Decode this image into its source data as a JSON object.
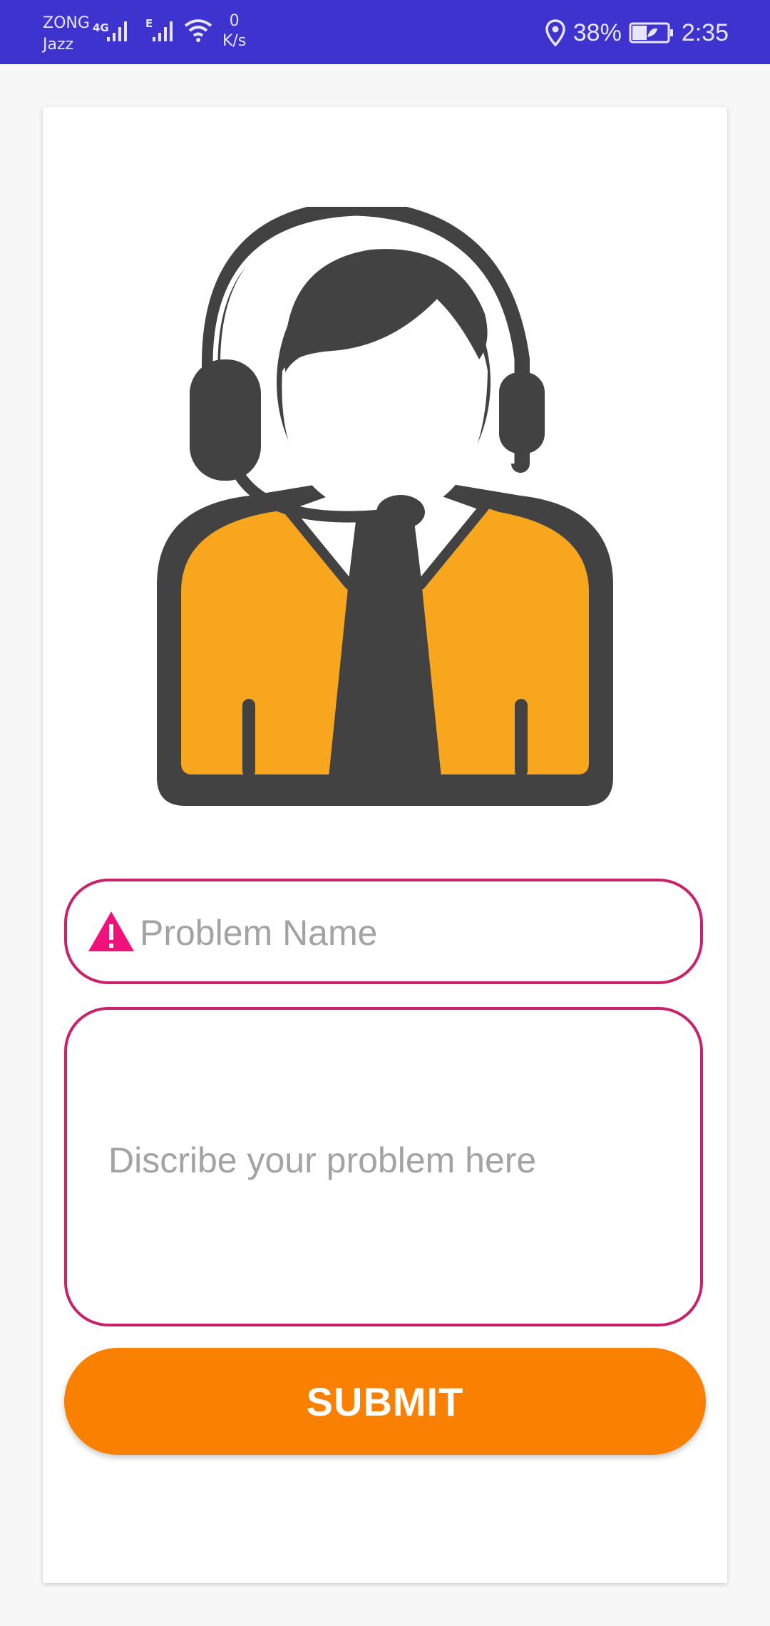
{
  "status_bar": {
    "carrier1": "ZONG",
    "network1": "4G",
    "carrier2": "Jazz",
    "network2": "E",
    "speed_value": "0",
    "speed_unit": "K/s",
    "battery": "38%",
    "time": "2:35"
  },
  "form": {
    "problem_name_placeholder": "Problem Name",
    "description_placeholder": "Discribe your problem here",
    "submit_label": "SUBMIT"
  },
  "colors": {
    "status_bar": "#3F33CF",
    "field_border": "#C9226B",
    "warning_icon": "#F0127A",
    "submit_button": "#F98000",
    "agent_dark": "#424242",
    "agent_jacket": "#F7A61E"
  },
  "icons": {
    "hero": "customer-support-agent-icon",
    "field_error": "warning-icon"
  }
}
